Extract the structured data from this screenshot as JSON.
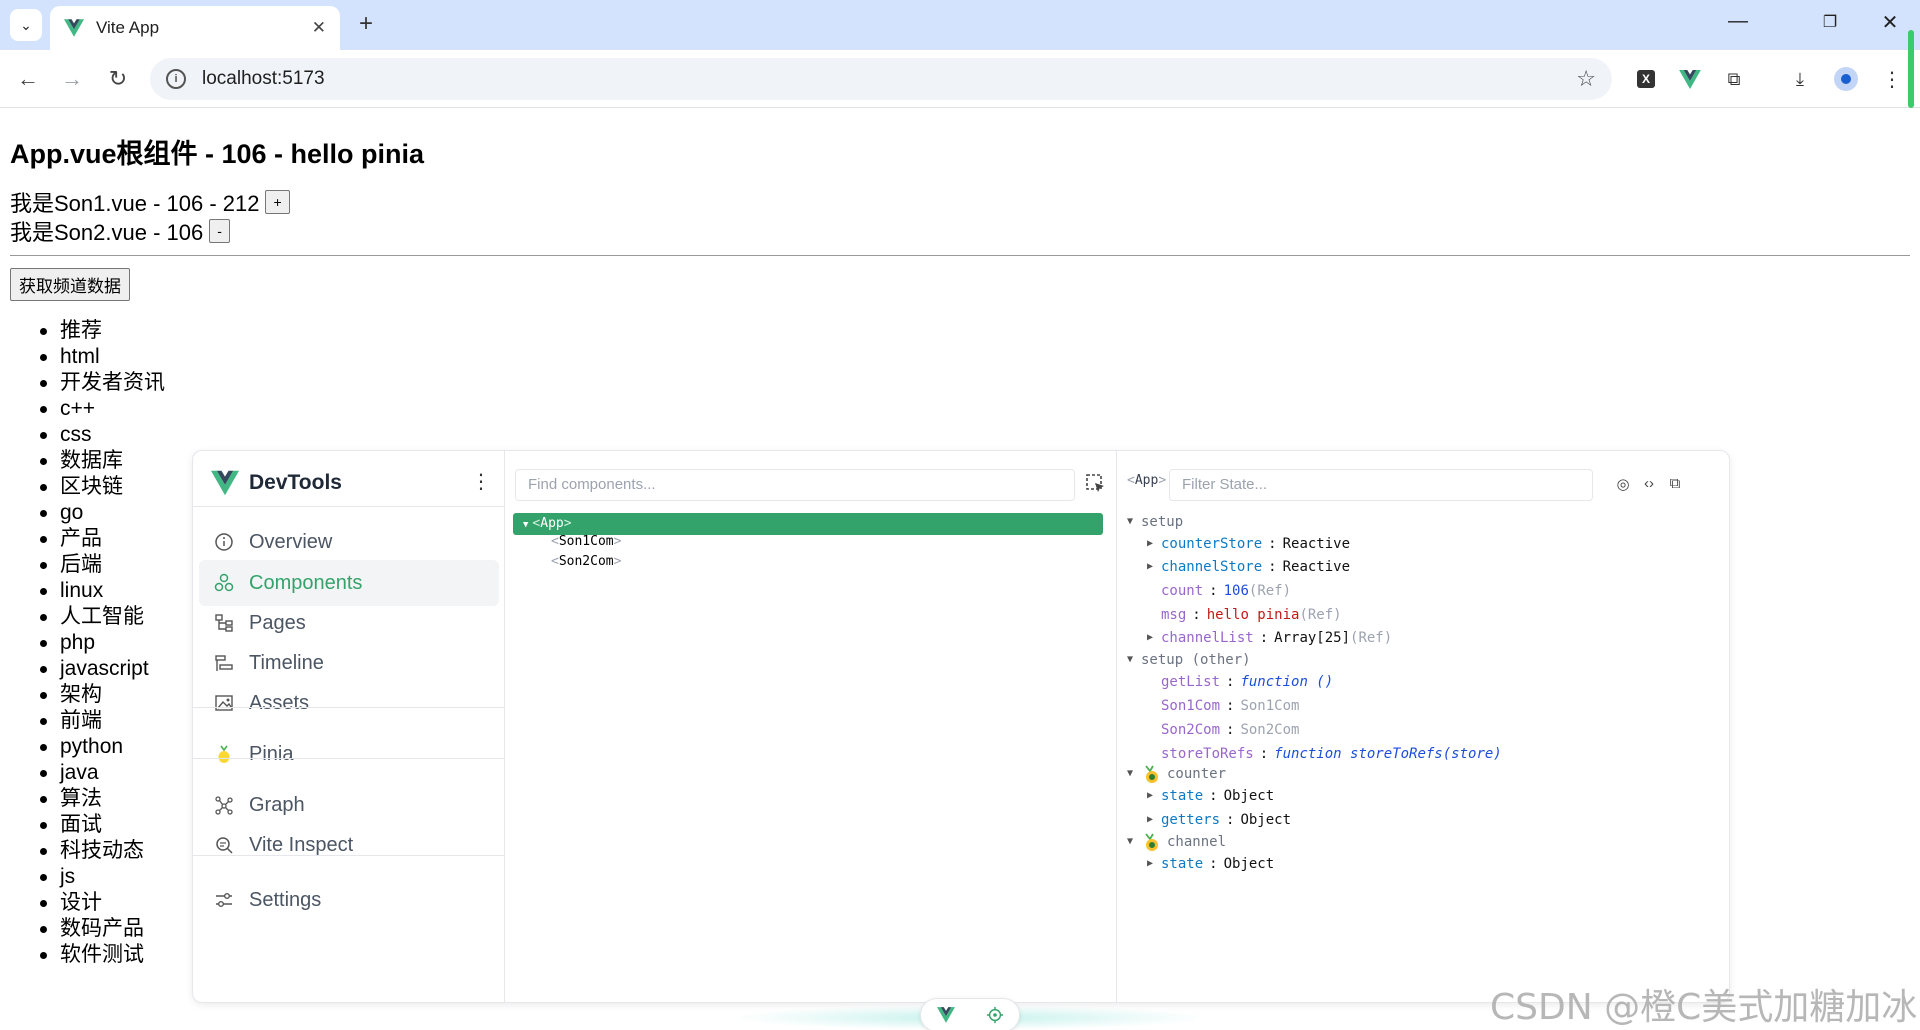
{
  "browser": {
    "tab_title": "Vite App",
    "url": "localhost:5173",
    "new_tab": "+",
    "close": "✕",
    "window": {
      "minimize": "—",
      "restore": "❐",
      "close": "✕"
    }
  },
  "page": {
    "heading": "App.vue根组件 - 106 - hello pinia",
    "son1": {
      "text": "我是Son1.vue - 106 - 212",
      "button": "+"
    },
    "son2": {
      "text": "我是Son2.vue - 106",
      "button": "-"
    },
    "fetch_button": "获取频道数据",
    "channels": [
      "推荐",
      "html",
      "开发者资讯",
      "c++",
      "css",
      "数据库",
      "区块链",
      "go",
      "产品",
      "后端",
      "linux",
      "人工智能",
      "php",
      "javascript",
      "架构",
      "前端",
      "python",
      "java",
      "算法",
      "面试",
      "科技动态",
      "js",
      "设计",
      "数码产品",
      "软件测试"
    ]
  },
  "devtools": {
    "brand": "DevTools",
    "nav": {
      "overview": "Overview",
      "components": "Components",
      "pages": "Pages",
      "timeline": "Timeline",
      "assets": "Assets",
      "pinia": "Pinia",
      "graph": "Graph",
      "vite_inspect": "Vite Inspect",
      "settings": "Settings"
    },
    "find_placeholder": "Find components...",
    "tree": {
      "app": "App",
      "son1": "Son1Com",
      "son2": "Son2Com"
    },
    "crumb": "App",
    "filter_placeholder": "Filter State...",
    "state": {
      "setup": "setup",
      "counterStore_k": "counterStore",
      "counterStore_v": "Reactive",
      "channelStore_k": "channelStore",
      "channelStore_v": "Reactive",
      "count_k": "count",
      "count_v": "106",
      "count_t": "(Ref)",
      "msg_k": "msg",
      "msg_v": "hello pinia",
      "msg_t": "(Ref)",
      "channelList_k": "channelList",
      "channelList_v": "Array[25]",
      "channelList_t": "(Ref)",
      "setup_other": "setup (other)",
      "getList_k": "getList",
      "getList_v": "function ()",
      "son1_k": "Son1Com",
      "son1_v": "Son1Com",
      "son2_k": "Son2Com",
      "son2_v": "Son2Com",
      "storeToRefs_k": "storeToRefs",
      "storeToRefs_v": "function storeToRefs(store)",
      "counter": "counter",
      "counter_state_k": "state",
      "counter_state_v": "Object",
      "counter_getters_k": "getters",
      "counter_getters_v": "Object",
      "channel": "channel",
      "channel_state_k": "state",
      "channel_state_v": "Object"
    }
  },
  "watermark": "CSDN @橙C美式加糖加冰",
  "colors": {
    "vue_green": "#34a36b",
    "chrome_blue": "#d3e3fd"
  }
}
